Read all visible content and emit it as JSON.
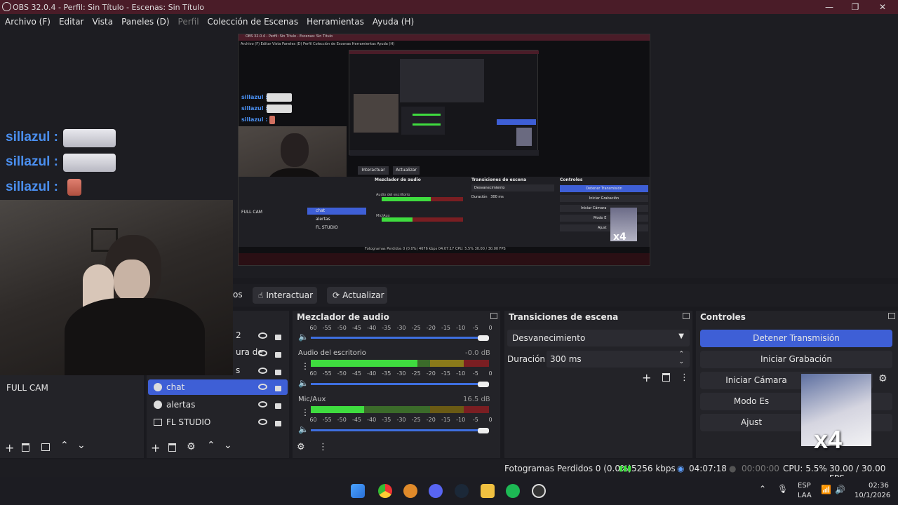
{
  "window": {
    "title": "OBS 32.0.4 - Perfil: Sin Título - Escenas: Sin Título"
  },
  "menu": [
    "Archivo (F)",
    "Editar",
    "Vista",
    "Paneles (D)",
    "Perfil",
    "Colección de Escenas",
    "Herramientas",
    "Ayuda (H)"
  ],
  "chat": {
    "user": "sillazul",
    "sep": ":"
  },
  "toolbar": {
    "partial": "os",
    "interact": "Interactuar",
    "refresh": "Actualizar"
  },
  "scenes": {
    "items": [
      "FULL CAM"
    ]
  },
  "sources": {
    "partial": [
      "2",
      "ura de",
      "s"
    ],
    "items": [
      "chat",
      "alertas",
      "FL STUDIO"
    ]
  },
  "mixer": {
    "title": "Mezclador de audio",
    "scale": [
      "-60",
      "-55",
      "-50",
      "-45",
      "-40",
      "-35",
      "-30",
      "-25",
      "-20",
      "-15",
      "-10",
      "-5",
      "0"
    ],
    "channels": [
      {
        "name": "Audio del escritorio",
        "db": "-0.0 dB",
        "level": 0.6
      },
      {
        "name": "Mic/Aux",
        "db": "16.5 dB",
        "level": 0.3
      }
    ]
  },
  "transitions": {
    "title": "Transiciones de escena",
    "selected": "Desvanecimiento",
    "duration_label": "Duración",
    "duration_value": "300 ms"
  },
  "controls": {
    "title": "Controles",
    "buttons": [
      "Detener Transmisión",
      "Iniciar Grabación",
      "Iniciar Cámara",
      "Modo Es",
      "Ajust"
    ],
    "overlay_text": "x4"
  },
  "status": {
    "dropped": "Fotogramas Perdidos 0 (0.0%)",
    "bitrate": "5256 kbps",
    "stream_time": "04:07:18",
    "rec_time": "00:00:00",
    "cpu": "CPU: 5.5%",
    "fps": "30.00 / 30.00 FPS"
  },
  "taskbar": {
    "lang1": "ESP",
    "lang2": "LAA",
    "time": "02:36",
    "date": "10/1/2026"
  },
  "colors": {
    "accent": "#3e5fd6",
    "title_bar": "#4a1c28"
  },
  "nested_preview": {
    "title": "OBS 32.0.4 - Perfil: Sin Título - Escenas: Sin Título",
    "menu": "Archivo (F)  Editar  Vista  Paneles (D)  Perfil  Colección de Escenas  Herramientas  Ayuda (H)",
    "chat_user": "sillazul",
    "scene": "FULL CAM",
    "sources": [
      "chat",
      "alertas",
      "FL STUDIO"
    ],
    "mixer_title": "Mezclador de audio",
    "mixer_ch1": "Audio del escritorio",
    "mixer_ch2": "Mic/Aux",
    "trans_title": "Transiciones de escena",
    "trans_sel": "Desvanecimiento",
    "duration": "Duración",
    "duration_val": "300 ms",
    "controls_title": "Controles",
    "btn1": "Detener Transmisión",
    "btn2": "Iniciar Grabación",
    "btn3": "Iniciar Cámara",
    "btn4": "Modo E",
    "btn5": "Ajust",
    "interact": "Interactuar",
    "refresh": "Actualizar",
    "status": "Fotogramas Perdidos 0 (0.0%)   4676 kbps   04:07:17   CPU: 5.5%   30.00 / 30.00 FPS",
    "overlay": "x4"
  }
}
